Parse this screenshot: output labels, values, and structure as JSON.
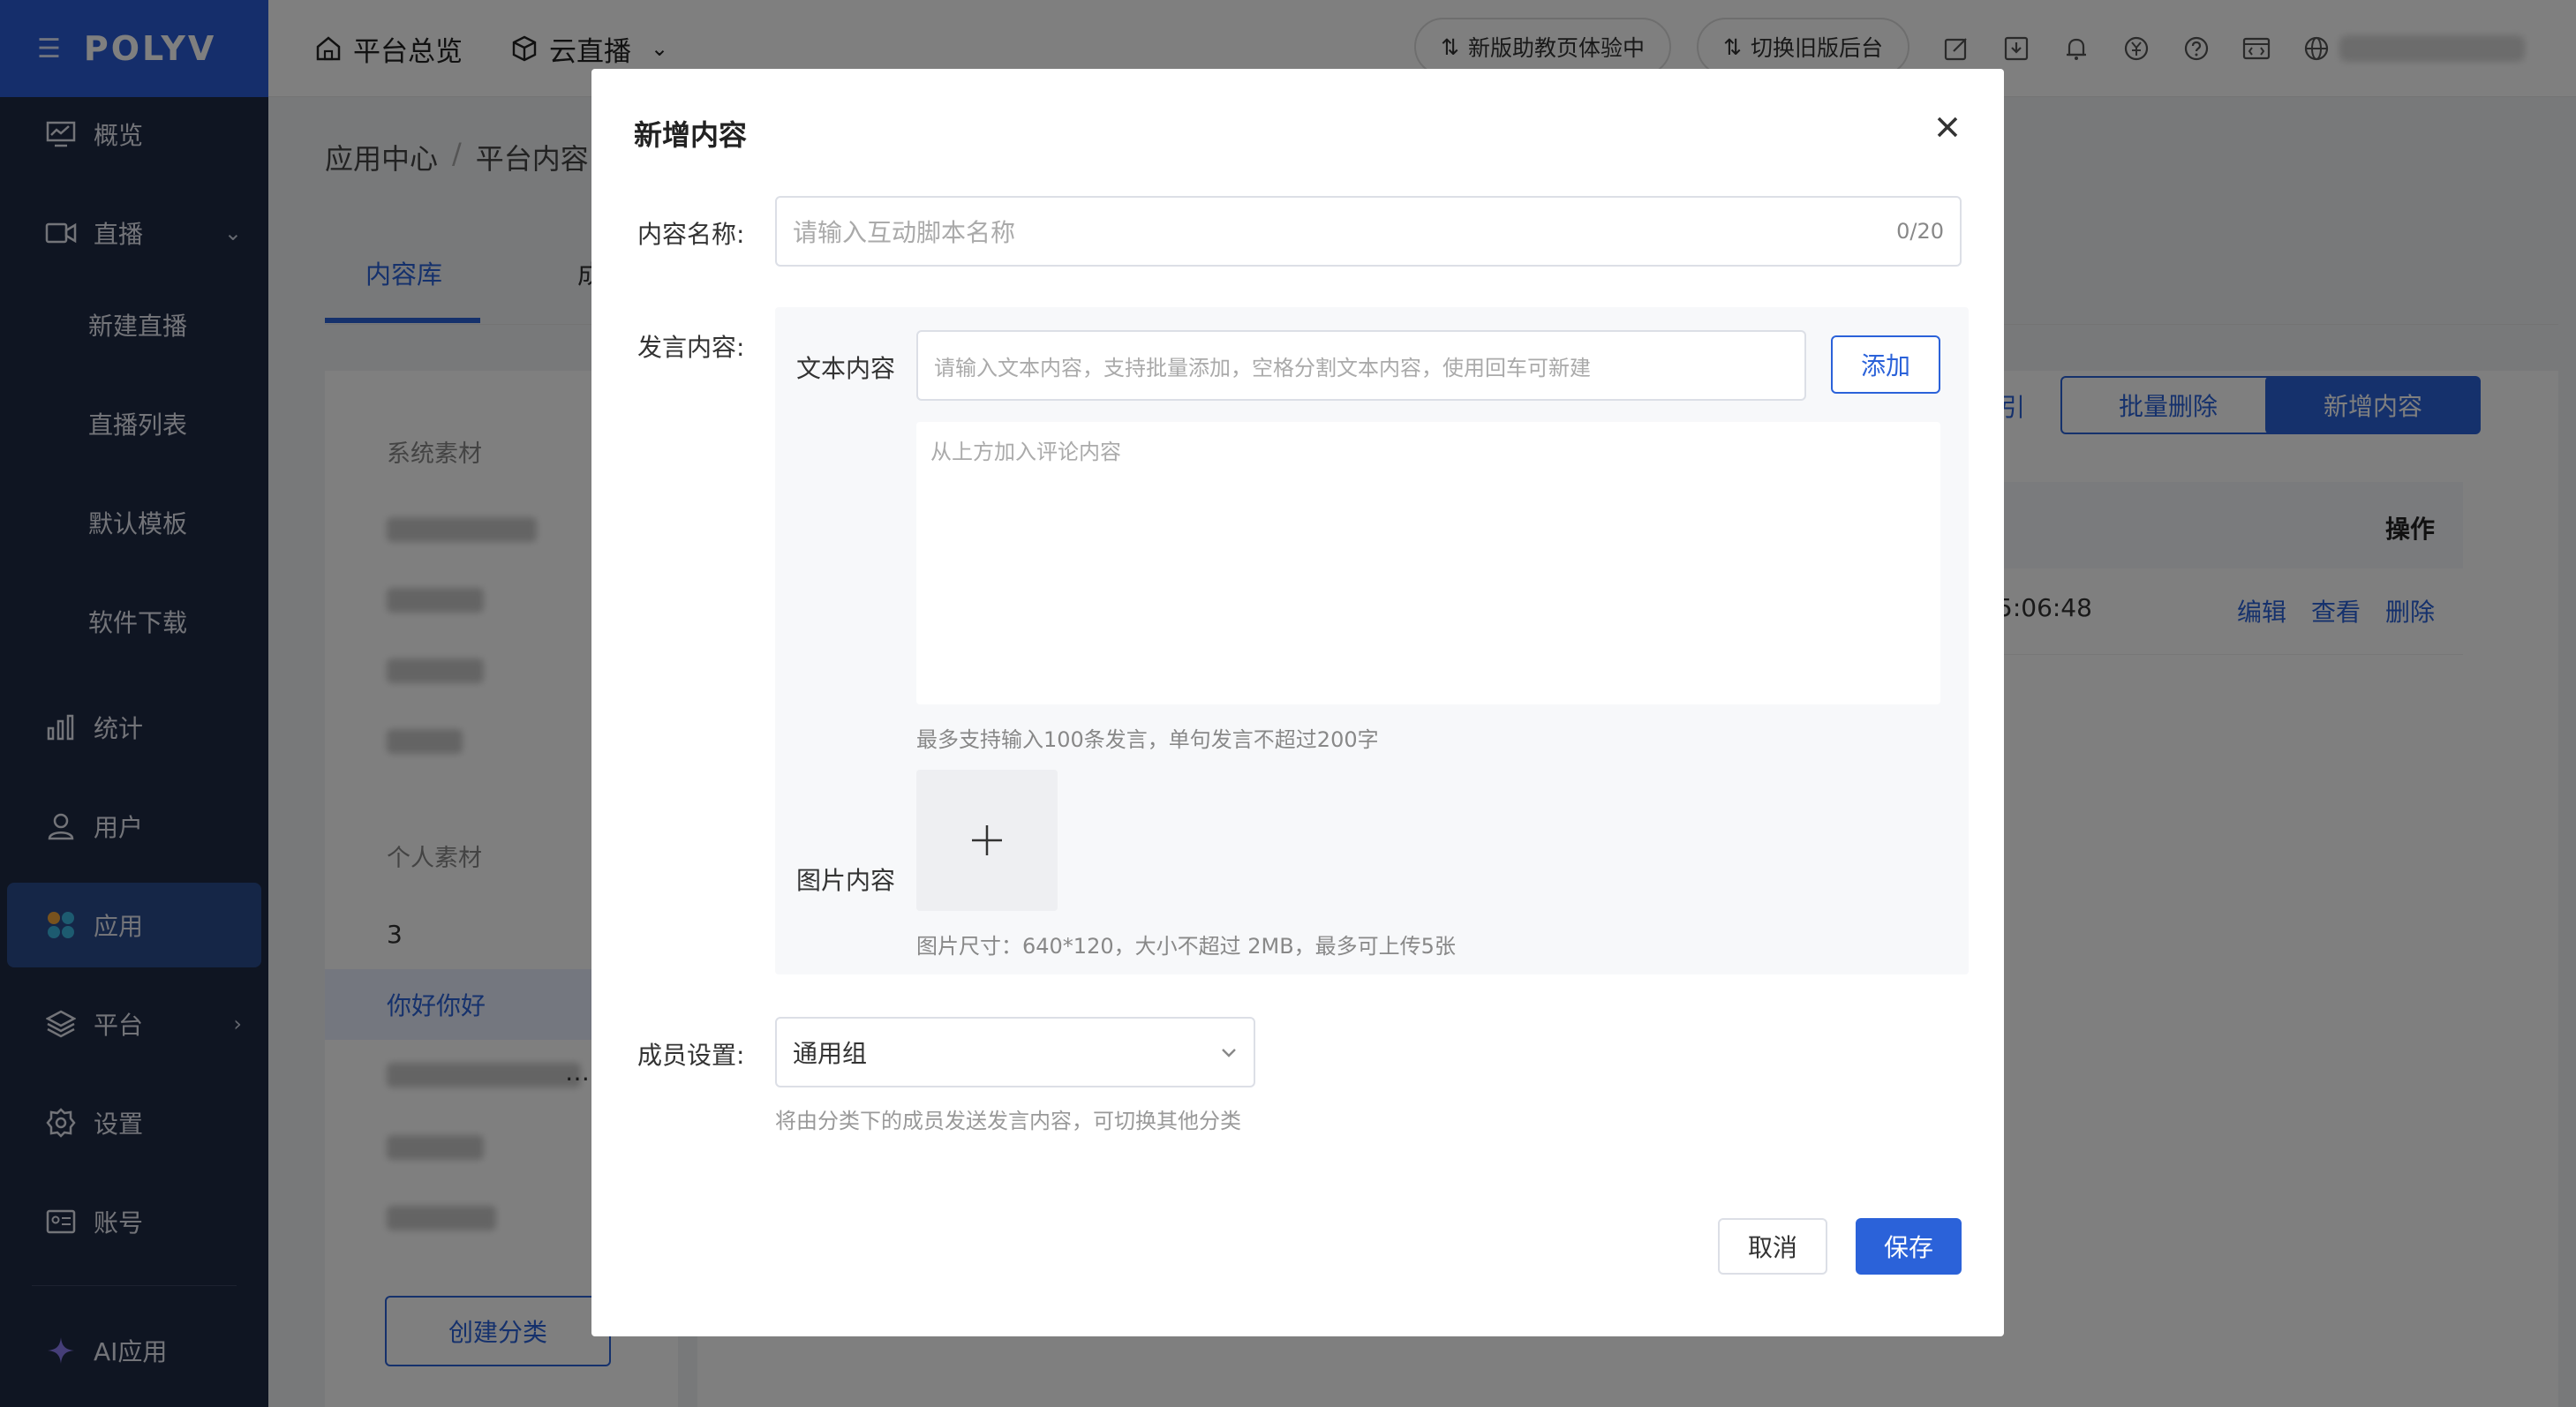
{
  "sidebar": {
    "logo": "POLYV",
    "items": [
      {
        "label": "概览"
      },
      {
        "label": "直播"
      },
      {
        "label": "新建直播"
      },
      {
        "label": "直播列表"
      },
      {
        "label": "默认模板"
      },
      {
        "label": "软件下载"
      },
      {
        "label": "统计"
      },
      {
        "label": "用户"
      },
      {
        "label": "应用"
      },
      {
        "label": "平台"
      },
      {
        "label": "设置"
      },
      {
        "label": "账号"
      },
      {
        "label": "AI应用"
      }
    ]
  },
  "topbar": {
    "home": "平台总览",
    "product": "云直播",
    "pill_new": "新版助教页体验中",
    "pill_old": "切换旧版后台"
  },
  "breadcrumb": {
    "first": "应用中心",
    "second": "平台内容"
  },
  "tabs": {
    "active": "内容库",
    "second": "成"
  },
  "left_panel": {
    "system_label": "系统素材",
    "personal_label": "个人素材",
    "item_3": "3",
    "selected": "你好你好",
    "ellipsis": "…",
    "create_button": "创建分类"
  },
  "toolbar": {
    "partial": "引",
    "batch_delete": "批量删除",
    "add_new": "新增内容"
  },
  "table": {
    "op_header": "操作",
    "row_time": "5:06:48",
    "edit": "编辑",
    "view": "查看",
    "delete": "删除"
  },
  "modal": {
    "title": "新增内容",
    "name_label": "内容名称:",
    "name_placeholder": "请输入互动脚本名称",
    "name_counter": "0/20",
    "speak_label": "发言内容:",
    "text_label": "文本内容",
    "text_placeholder": "请输入文本内容，支持批量添加，空格分割文本内容，使用回车可新建",
    "add_button": "添加",
    "comment_placeholder": "从上方加入评论内容",
    "text_hint": "最多支持输入100条发言，单句发言不超过200字",
    "image_label": "图片内容",
    "image_hint": "图片尺寸：640*120，大小不超过 2MB，最多可上传5张",
    "member_label": "成员设置:",
    "member_value": "通用组",
    "member_hint": "将由分类下的成员发送发言内容，可切换其他分类",
    "cancel_button": "取消",
    "save_button": "保存"
  }
}
